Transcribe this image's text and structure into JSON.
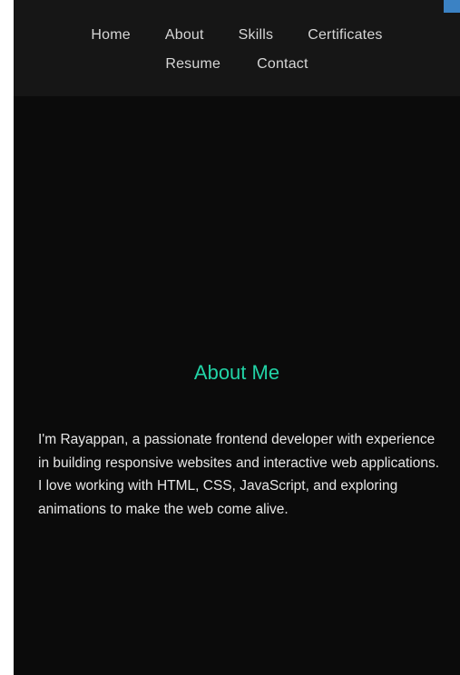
{
  "nav": {
    "row1": [
      "Home",
      "About",
      "Skills",
      "Certificates"
    ],
    "row2": [
      "Resume",
      "Contact"
    ]
  },
  "about": {
    "title": "About Me",
    "text": "I'm Rayappan, a passionate frontend developer with experience in building responsive websites and interactive web applications. I love working with HTML, CSS, JavaScript, and exploring animations to make the web come alive."
  },
  "colors": {
    "background": "#0b0b0b",
    "navbar": "#161616",
    "accent": "#22d3a6",
    "text": "#e6e6e6"
  }
}
